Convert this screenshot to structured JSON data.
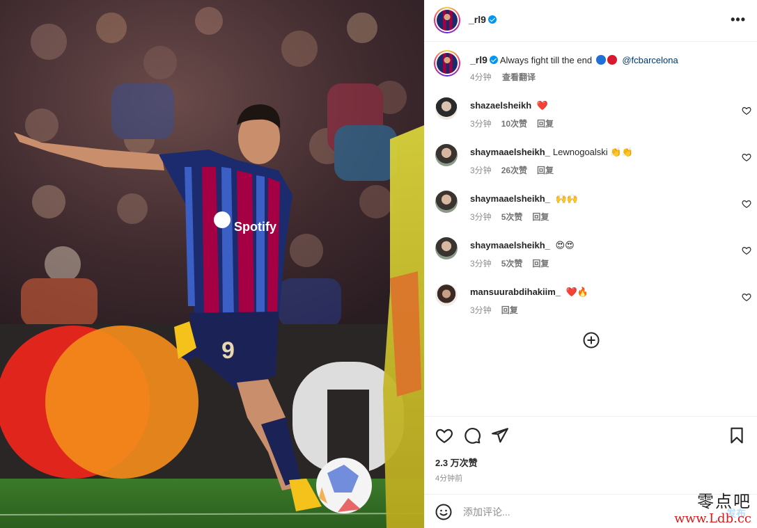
{
  "post": {
    "photo_alt": "",
    "author": {
      "username": "_rl9",
      "verified": true
    },
    "more_menu": "•••",
    "caption": {
      "username": "_rl9",
      "text": "Always fight till the end",
      "dots": [
        "#1f6fd6",
        "#d7192f"
      ],
      "mention": "@fcbarcelona",
      "time": "4分钟",
      "translate_label": "查看翻译"
    }
  },
  "comments": [
    {
      "user": "shazaelsheikh",
      "text": "",
      "emoji": "❤️",
      "time": "3分钟",
      "likes": "10次赞",
      "reply": "回复"
    },
    {
      "user": "shaymaaelsheikh_",
      "text": "Lewnogoalski",
      "emoji": "👏👏",
      "time": "3分钟",
      "likes": "26次赞",
      "reply": "回复"
    },
    {
      "user": "shaymaaelsheikh_",
      "text": "",
      "emoji": "🙌🙌",
      "time": "3分钟",
      "likes": "5次赞",
      "reply": "回复"
    },
    {
      "user": "shaymaaelsheikh_",
      "text": "",
      "emoji": "😍😍",
      "time": "3分钟",
      "likes": "5次赞",
      "reply": "回复"
    },
    {
      "user": "mansuurabdihakiim_",
      "text": "",
      "emoji": "❤️🔥",
      "time": "3分钟",
      "likes": "",
      "reply": "回复"
    }
  ],
  "actions": {
    "likes_count": "2.3 万次赞",
    "post_time": "4分钟前"
  },
  "comment_box": {
    "placeholder": "添加评论...",
    "publish_label": "发布"
  },
  "watermark": {
    "cn": "零点吧",
    "url": "www.Ldb.cc"
  },
  "colors": {
    "text": "#262626",
    "muted": "#8e8e8e",
    "link": "#00376b",
    "verified": "#0095f6",
    "publish": "#b2dffc"
  }
}
